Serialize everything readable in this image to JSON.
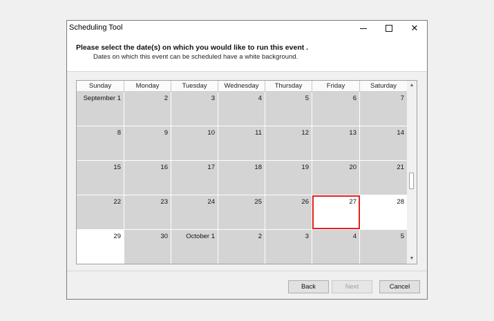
{
  "window": {
    "title": "Scheduling Tool"
  },
  "window_controls": {
    "minimize": "minimize",
    "maximize": "maximize",
    "close": "✕"
  },
  "header": {
    "title": "Please select the date(s) on which you would like to run this event  .",
    "subtitle": "Dates on which this event can be scheduled have a white background."
  },
  "calendar": {
    "days": [
      "Sunday",
      "Monday",
      "Tuesday",
      "Wednesday",
      "Thursday",
      "Friday",
      "Saturday"
    ],
    "weeks": [
      [
        {
          "label": "September 1",
          "state": "unavailable"
        },
        {
          "label": "2",
          "state": "unavailable"
        },
        {
          "label": "3",
          "state": "unavailable"
        },
        {
          "label": "4",
          "state": "unavailable"
        },
        {
          "label": "5",
          "state": "unavailable"
        },
        {
          "label": "6",
          "state": "unavailable"
        },
        {
          "label": "7",
          "state": "unavailable"
        }
      ],
      [
        {
          "label": "8",
          "state": "unavailable"
        },
        {
          "label": "9",
          "state": "unavailable"
        },
        {
          "label": "10",
          "state": "unavailable"
        },
        {
          "label": "11",
          "state": "unavailable"
        },
        {
          "label": "12",
          "state": "unavailable"
        },
        {
          "label": "13",
          "state": "unavailable"
        },
        {
          "label": "14",
          "state": "unavailable"
        }
      ],
      [
        {
          "label": "15",
          "state": "unavailable"
        },
        {
          "label": "16",
          "state": "unavailable"
        },
        {
          "label": "17",
          "state": "unavailable"
        },
        {
          "label": "18",
          "state": "unavailable"
        },
        {
          "label": "19",
          "state": "unavailable"
        },
        {
          "label": "20",
          "state": "unavailable"
        },
        {
          "label": "21",
          "state": "unavailable"
        }
      ],
      [
        {
          "label": "22",
          "state": "unavailable"
        },
        {
          "label": "23",
          "state": "unavailable"
        },
        {
          "label": "24",
          "state": "unavailable"
        },
        {
          "label": "25",
          "state": "unavailable"
        },
        {
          "label": "26",
          "state": "unavailable"
        },
        {
          "label": "27",
          "state": "selected"
        },
        {
          "label": "28",
          "state": "available"
        }
      ],
      [
        {
          "label": "29",
          "state": "available"
        },
        {
          "label": "30",
          "state": "unavailable"
        },
        {
          "label": "October 1",
          "state": "unavailable"
        },
        {
          "label": "2",
          "state": "unavailable"
        },
        {
          "label": "3",
          "state": "unavailable"
        },
        {
          "label": "4",
          "state": "unavailable"
        },
        {
          "label": "5",
          "state": "unavailable"
        }
      ]
    ],
    "colors": {
      "available": "#ffffff",
      "unavailable": "#d4d4d4",
      "selected_border": "#e02020"
    }
  },
  "scrollbar": {
    "up_arrow": "▲",
    "down_arrow": "▼"
  },
  "buttons": {
    "back": "Back",
    "next": "Next",
    "cancel": "Cancel"
  }
}
